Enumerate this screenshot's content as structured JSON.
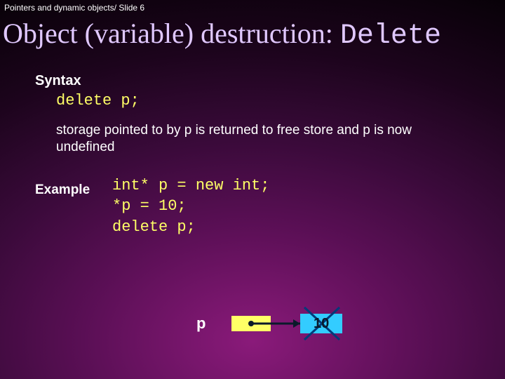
{
  "header": {
    "breadcrumb": "Pointers and dynamic objects/ Slide 6"
  },
  "title": {
    "text_part": "Object (variable) destruction: ",
    "code_part": "Delete"
  },
  "syntax": {
    "heading": "Syntax",
    "code": "delete p;",
    "description": "storage pointed to by p is returned to free store and p is now undefined"
  },
  "example": {
    "heading": "Example",
    "code": "int* p = new int;\n*p = 10;\ndelete p;"
  },
  "diagram": {
    "pointer_label": "p",
    "value_label": "10",
    "pointer_box_fill": "#ffff66",
    "value_box_fill": "#33ccff",
    "cross_color": "#003a7a"
  }
}
